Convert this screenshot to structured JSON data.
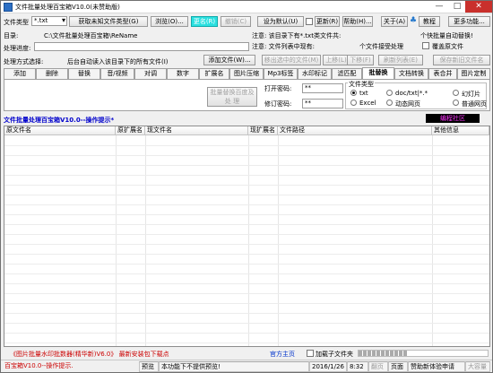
{
  "window": {
    "title": "文件批量处理百宝箱V10.0(未赞助版)"
  },
  "toolbar": {
    "file_type_label": "文件类型",
    "file_type_value": "*.txt",
    "get_unknown_type": "获取未知文件类型(G)",
    "browse": "浏览(O)...",
    "rename": "更名(R)",
    "undo": "撤销(C)",
    "set_default": "设为默认(U)",
    "refresh": "更新(R)",
    "help": "帮助(H)...",
    "about": "关于(A)",
    "tutorial": "教程",
    "more": "更多功能..."
  },
  "paths": {
    "dir_label": "目录:",
    "dir_value": "C:\\文件批量处理百宝箱\\ReName",
    "note1": "注意: 该目录下有*.txt类文件共:",
    "note2": "注意: 文件列表中现有:",
    "auto_update": "个快批量自动替换!",
    "receive_label": "个文件接受处理",
    "overwrite": "覆盖原文件",
    "progress_label": "处理进度:",
    "method_label": "处理方式选择:",
    "method_text": "后台自动读入该目录下的所有文件(I)",
    "add_file": "添加文件(W)...",
    "remove_selected": "移出选中的文件(M)",
    "move_up": "上移(L)",
    "move_down": "下移(F)",
    "refresh_list": "刷新列表(E)",
    "save_new": "保存新旧文件名"
  },
  "tabs": [
    "添加",
    "删除",
    "替换",
    "音/视频",
    "对调",
    "数字",
    "扩展名",
    "图片压缩",
    "Mp3标签",
    "水印标记",
    "滤匹配",
    "批替换",
    "文档转换",
    "表合并",
    "图片定制"
  ],
  "panel": {
    "start_btn": "批量替换百度及处 理",
    "open_pwd_label": "打开密码:",
    "open_pwd_value": "**",
    "edit_pwd_label": "修订密码:",
    "edit_pwd_value": "**",
    "file_type_group": "文件类型",
    "opt_txt": "txt",
    "opt_doc": "doc/txt|*.*",
    "opt_ppt": "幻灯片",
    "opt_excel": "Excel",
    "opt_dynamic": "动态网页",
    "opt_static": "普通网页"
  },
  "prompt": {
    "text": "文件批量处理百宝箱V10.0--操作提示*",
    "badge": "编程社区"
  },
  "grid": {
    "columns": [
      "原文件名",
      "原扩展名",
      "现文件名",
      "现扩展名",
      "文件路径",
      "其他信息"
    ]
  },
  "footer": {
    "promo": "《图片批量水印批数器(精华新)V6.0》 最新安装包下载点",
    "homepage": "官方主页",
    "child_folder": "加载子文件夹"
  },
  "status": {
    "op_prompt": "百宝箱V10.0--操作提示.",
    "preview_label": "预览",
    "preview_text": "本功能下不提供预览!",
    "date": "2016/1/26",
    "time": "8:32",
    "page_label": "翻页",
    "page_value": "页面",
    "sponsor": "赞助新体验申请",
    "big_size": "大容量"
  },
  "colors": {
    "accent_cyan": "#2ae0e0",
    "prompt_blue": "#0000cc",
    "badge_bg": "#000000",
    "badge_fg": "#ff33ff",
    "footer_red": "#cc0000",
    "link_blue": "#0033cc"
  }
}
